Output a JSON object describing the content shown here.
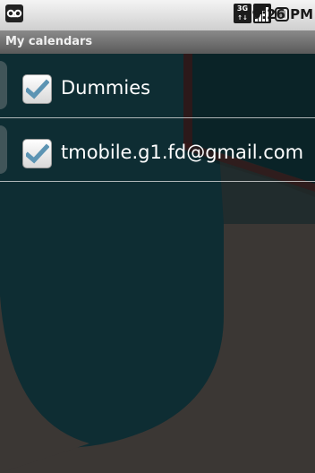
{
  "status_bar": {
    "network_top": "3G",
    "network_bottom": "↑↓",
    "time": "9:26 PM",
    "icons": [
      "voicemail-icon",
      "network-3g-icon",
      "signal-icon",
      "battery-icon"
    ]
  },
  "title_bar": {
    "title": "My calendars"
  },
  "calendars": [
    {
      "name": "Dummies",
      "checked": true
    },
    {
      "name": "tmobile.g1.fd@gmail.com",
      "checked": true
    }
  ],
  "colors": {
    "wallpaper_teal": "#0e2d33",
    "wallpaper_gray": "#3b3734",
    "checkmark": "#5c94b3",
    "text": "#ffffff"
  }
}
